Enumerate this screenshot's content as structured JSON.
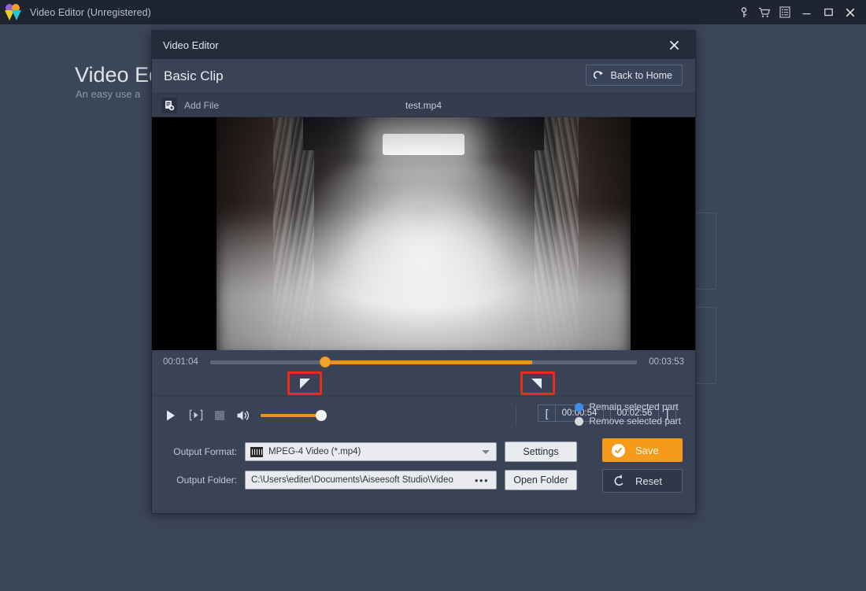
{
  "app": {
    "title": "Video Editor (Unregistered)",
    "logo_icon": "aiseesoft-logo-icon",
    "toolbar_icons": [
      "key-icon",
      "shopping-cart-icon",
      "list-menu-icon"
    ],
    "window_buttons": {
      "minimize": "—",
      "maximize": "☐",
      "close": "✕"
    },
    "background": {
      "heading": "Video Edit",
      "subheading": "An easy use a"
    }
  },
  "dialog": {
    "title": "Video Editor",
    "close_icon": "close-icon",
    "section_title": "Basic Clip",
    "back_home_label": "Back to Home",
    "back_home_icon": "redo-arrow-icon",
    "file_row": {
      "add_file_icon": "add-file-icon",
      "add_file_label": "Add File",
      "file_name": "test.mp4"
    },
    "preview": {
      "description": "foggy corridor with bright ceiling light"
    },
    "timeline": {
      "start_time": "00:01:04",
      "end_time": "00:03:53",
      "selection_start_pct": 27,
      "selection_width_pct": 48.5,
      "playhead_pct": 27,
      "left_marker_icon": "trim-start-marker-icon",
      "right_marker_icon": "trim-end-marker-icon",
      "highlight_color": "#ee2b18",
      "track_color": "#5d6677",
      "selection_color": "#ef9122"
    },
    "controls": {
      "play_icon": "play-icon",
      "step_icon": "step-frame-icon",
      "stop_icon": "stop-icon",
      "volume_icon": "volume-icon",
      "volume_value": 100,
      "trim_start_bracket": "[",
      "trim_end_bracket": "]",
      "trim_start_time": "00:00:54",
      "trim_end_time": "00:02:56"
    },
    "selection_mode": {
      "options": [
        {
          "label": "Remain selected part",
          "selected": true
        },
        {
          "label": "Remove selected part",
          "selected": false
        }
      ],
      "selected_color": "#3f8be8",
      "unselected_color": "#d9dbdc"
    },
    "output": {
      "format_label": "Output Format:",
      "format_value": "MPEG-4 Video (*.mp4)",
      "format_icon": "film-strip-icon",
      "settings_label": "Settings",
      "folder_label": "Output Folder:",
      "folder_value": "C:\\Users\\editer\\Documents\\Aiseesoft Studio\\Video",
      "folder_browse_icon": "ellipsis-icon",
      "open_folder_label": "Open Folder"
    },
    "actions": {
      "save_label": "Save",
      "save_icon": "check-circle-icon",
      "save_color": "#f59a1b",
      "reset_label": "Reset",
      "reset_icon": "reset-arrow-icon"
    }
  }
}
